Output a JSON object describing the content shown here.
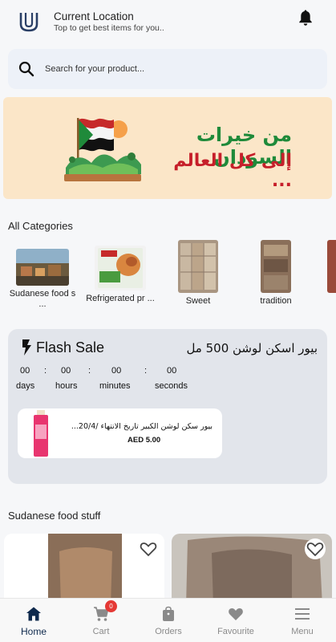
{
  "header": {
    "title": "Current Location",
    "subtitle": "Top to get best items for you..",
    "logo_icon": "brand-logo-icon",
    "notification_icon": "bell-icon"
  },
  "search": {
    "placeholder": "Search for your product...",
    "icon": "search-icon"
  },
  "banner": {
    "line1": "من خيرات السودان",
    "line2": "إلى كل العالم ...",
    "accent_green": "#1f8a3a",
    "accent_red": "#c61f2a"
  },
  "categories_section": {
    "title": "All Categories",
    "items": [
      {
        "label": "Sudanese food s ..."
      },
      {
        "label": "Refrigerated pr ..."
      },
      {
        "label": "Sweet"
      },
      {
        "label": "tradition"
      }
    ]
  },
  "flash_sale": {
    "title": "Flash Sale",
    "product_title": "بيور اسكن لوشن 500 مل",
    "countdown": {
      "days": "00",
      "hours": "00",
      "minutes": "00",
      "seconds": "00",
      "days_label": "days",
      "hours_label": "hours",
      "minutes_label": "minutes",
      "seconds_label": "seconds",
      "separator": ":"
    },
    "card": {
      "name": "بيور سكن لوشن الكبير تاريخ الانتهاء /20/4...",
      "price": "AED 5.00"
    }
  },
  "products_section": {
    "title": "Sudanese food stuff"
  },
  "bottom_nav": {
    "items": [
      {
        "label": "Home",
        "icon": "home-icon"
      },
      {
        "label": "Cart",
        "icon": "cart-icon",
        "badge": "0"
      },
      {
        "label": "Orders",
        "icon": "orders-bag-icon"
      },
      {
        "label": "Favourite",
        "icon": "heart-icon"
      },
      {
        "label": "Menu",
        "icon": "menu-icon"
      }
    ],
    "active_color": "#0f2a4d",
    "inactive_color": "#8a8a8a"
  }
}
